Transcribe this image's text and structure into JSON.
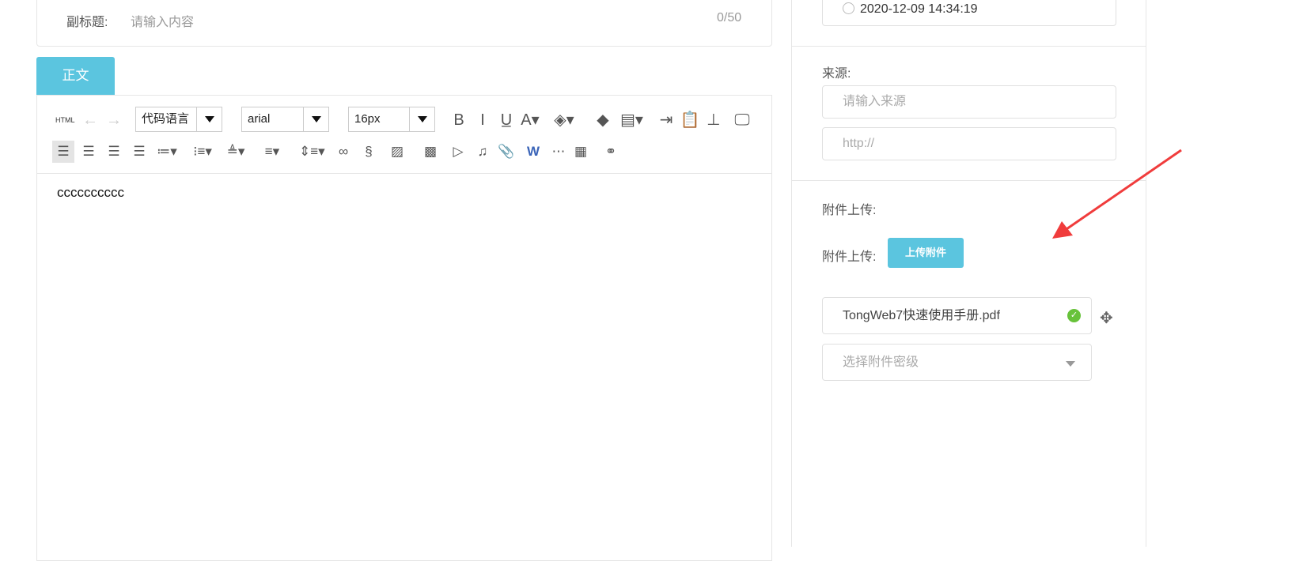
{
  "subtitle": {
    "label": "副标题:",
    "placeholder": "请输入内容",
    "count": "0/50"
  },
  "tab": {
    "label": "正文"
  },
  "toolbar": {
    "html_label": "HTML",
    "code_lang": "代码语言",
    "font_family": "arial",
    "font_size": "16px",
    "row1_icons": [
      "bold-icon",
      "italic-icon",
      "underline-icon",
      "font-color-icon",
      "background-color-icon",
      "eraser-icon",
      "template-icon",
      "indent-icon",
      "paste-text-icon",
      "format-brush-icon",
      "preview-icon"
    ],
    "row2_icons": [
      "align-left-icon",
      "align-right-icon",
      "align-center-icon",
      "align-justify-icon",
      "ordered-list-icon",
      "unordered-list-icon",
      "row-spacing-top-icon",
      "row-spacing-bottom-icon",
      "line-height-icon",
      "link-icon",
      "unlink-icon",
      "image-icon",
      "multi-image-icon",
      "video-icon",
      "music-icon",
      "attachment-icon",
      "word-image-icon",
      "page-break-icon",
      "table-icon",
      "search-replace-icon"
    ]
  },
  "editor": {
    "content": "cccccccccc"
  },
  "right": {
    "date": "2020-12-09 14:34:19",
    "source_label": "来源:",
    "source_placeholder": "请输入来源",
    "url_placeholder": "http://",
    "attach_label": "附件上传:",
    "attach_label2": "附件上传:",
    "upload_button": "上传附件",
    "file_name": "TongWeb7快速使用手册.pdf",
    "secrecy_placeholder": "选择附件密级"
  },
  "colors": {
    "accent": "#5bc5df",
    "success": "#67c23a",
    "annotation": "#f03c3c"
  }
}
